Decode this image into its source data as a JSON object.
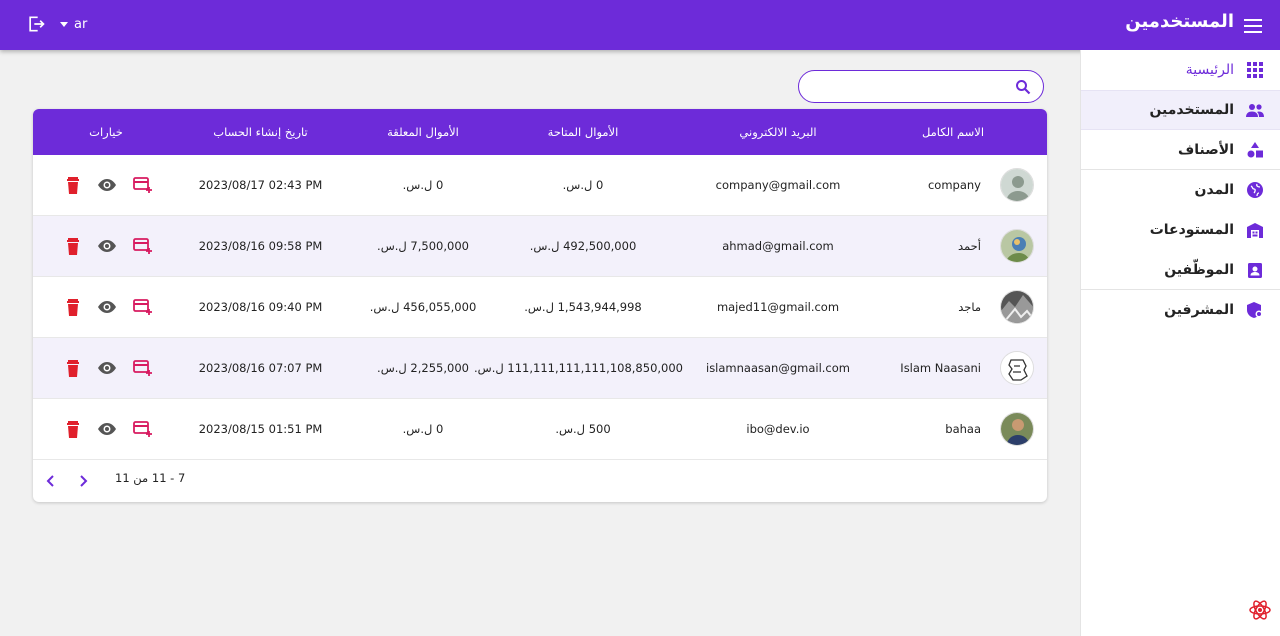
{
  "header": {
    "title": "المستخدمين",
    "language": "ar"
  },
  "sidebar": {
    "items": [
      {
        "label": "الرئيسية",
        "icon": "grid-icon"
      },
      {
        "label": "المستخدمين",
        "icon": "users-icon"
      },
      {
        "label": "الأصناف",
        "icon": "shapes-icon"
      },
      {
        "label": "المدن",
        "icon": "globe-icon"
      },
      {
        "label": "المستودعات",
        "icon": "warehouse-icon"
      },
      {
        "label": "الموظّفين",
        "icon": "badge-icon"
      },
      {
        "label": "المشرفين",
        "icon": "admin-shield-icon"
      }
    ]
  },
  "search": {
    "placeholder": "",
    "value": ""
  },
  "table": {
    "columns": [
      "الاسم الكامل",
      "البريد الالكتروني",
      "الأموال المتاحة",
      "الأموال المعلقة",
      "تاريخ إنشاء الحساب",
      "خيارات"
    ],
    "rows": [
      {
        "name": "company",
        "email": "company@gmail.com",
        "available": "0 ل.س.",
        "pending": "0 ل.س.",
        "created": "2023/08/17 02:43 PM"
      },
      {
        "name": "أحمد",
        "email": "ahmad@gmail.com",
        "available": "492,500,000 ل.س.",
        "pending": "7,500,000 ل.س.",
        "created": "2023/08/16 09:58 PM"
      },
      {
        "name": "ماجد",
        "email": "majed11@gmail.com",
        "available": "1,543,944,998 ل.س.",
        "pending": "456,055,000 ل.س.",
        "created": "2023/08/16 09:40 PM"
      },
      {
        "name": "Islam Naasani",
        "email": "islamnaasan@gmail.com",
        "available": "111,111,111,111,108,850,000 ل.س.",
        "pending": "2,255,000 ل.س.",
        "created": "2023/08/16 07:07 PM"
      },
      {
        "name": "bahaa",
        "email": "ibo@dev.io",
        "available": "500 ل.س.",
        "pending": "0 ل.س.",
        "created": "2023/08/15 01:51 PM"
      }
    ]
  },
  "pagination": {
    "range": "7 - 11 من 11"
  },
  "colors": {
    "primary": "#6d2bd9",
    "danger": "#e0202c",
    "accent_pink": "#d81b60",
    "row_alt": "#f3f1fb"
  }
}
